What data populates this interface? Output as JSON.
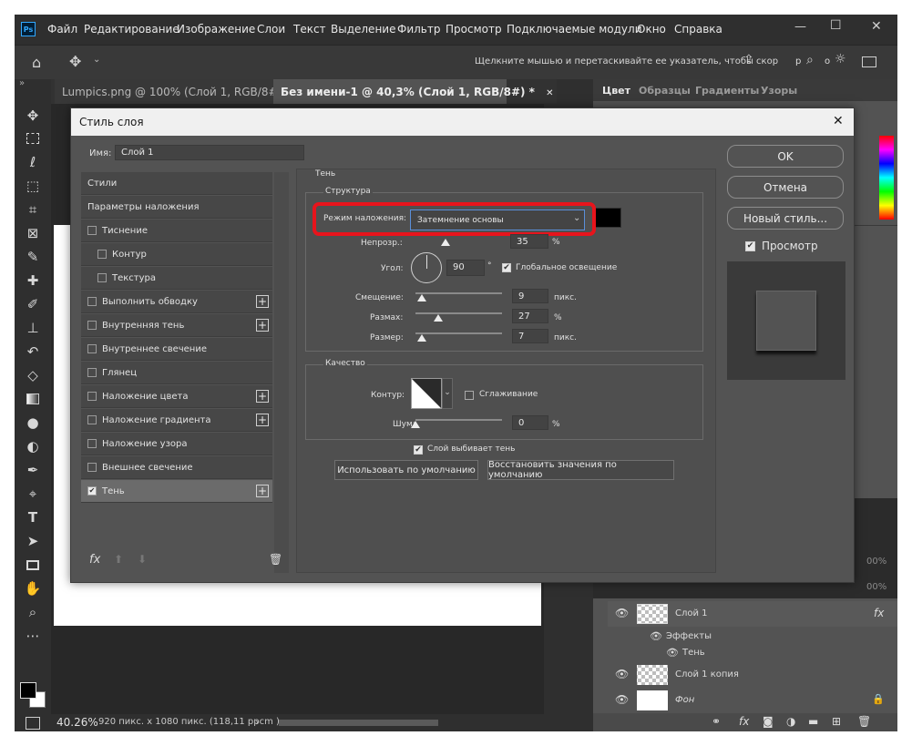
{
  "app": {
    "logo": "Ps",
    "menu": [
      "Файл",
      "Редактирование",
      "Изображение",
      "Слои",
      "Текст",
      "Выделение",
      "Фильтр",
      "Просмотр",
      "Подключаемые модули",
      "Окно",
      "Справка"
    ],
    "window_controls": {
      "minimize": "—",
      "maximize": "☐",
      "close": "✕"
    },
    "options_hint": "Щелкните мышью и перетаскивайте ее указатель, чтобы скор",
    "options_suffix_1": "р",
    "options_suffix_2": "о"
  },
  "tabs": [
    {
      "label": "Lumpics.png @ 100% (Слой 1, RGB/8#)",
      "close": "✕",
      "active": false
    },
    {
      "label": "Без имени-1 @ 40,3% (Слой 1, RGB/8#) *",
      "close": "✕",
      "active": true
    }
  ],
  "statusbar": {
    "zoom": "40.26%",
    "info": "920 пикс. x 1080 пикс. (118,11 ppcm )",
    "arrow": "›"
  },
  "panels": {
    "tabs": [
      "Цвет",
      "Образцы",
      "Градиенты",
      "Узоры"
    ],
    "zoom_values": [
      "00%",
      "00%"
    ],
    "layers": [
      {
        "name": "Слой 1",
        "fx": "fx"
      },
      {
        "name": "Эффекты"
      },
      {
        "name": "Тень"
      },
      {
        "name": "Слой 1 копия"
      },
      {
        "name": "Фон"
      }
    ],
    "footer_icons": [
      "link-icon",
      "fx-icon",
      "mask-icon",
      "adjustment-icon",
      "folder-icon",
      "new-layer-icon",
      "trash-icon"
    ]
  },
  "dialog": {
    "title": "Стиль слоя",
    "close": "✕",
    "name_label": "Имя:",
    "name_value": "Слой 1",
    "styles": [
      {
        "label": "Стили",
        "checkbox": false,
        "plus": false,
        "indent": false,
        "selected": false
      },
      {
        "label": "Параметры наложения",
        "checkbox": false,
        "plus": false,
        "indent": false,
        "selected": false
      },
      {
        "label": "Тиснение",
        "checkbox": true,
        "checked": false,
        "plus": false,
        "indent": false,
        "selected": false
      },
      {
        "label": "Контур",
        "checkbox": true,
        "checked": false,
        "plus": false,
        "indent": true,
        "selected": false
      },
      {
        "label": "Текстура",
        "checkbox": true,
        "checked": false,
        "plus": false,
        "indent": true,
        "selected": false
      },
      {
        "label": "Выполнить обводку",
        "checkbox": true,
        "checked": false,
        "plus": true,
        "indent": false,
        "selected": false
      },
      {
        "label": "Внутренняя тень",
        "checkbox": true,
        "checked": false,
        "plus": true,
        "indent": false,
        "selected": false
      },
      {
        "label": "Внутреннее свечение",
        "checkbox": true,
        "checked": false,
        "plus": false,
        "indent": false,
        "selected": false
      },
      {
        "label": "Глянец",
        "checkbox": true,
        "checked": false,
        "plus": false,
        "indent": false,
        "selected": false
      },
      {
        "label": "Наложение цвета",
        "checkbox": true,
        "checked": false,
        "plus": true,
        "indent": false,
        "selected": false
      },
      {
        "label": "Наложение градиента",
        "checkbox": true,
        "checked": false,
        "plus": true,
        "indent": false,
        "selected": false
      },
      {
        "label": "Наложение узора",
        "checkbox": true,
        "checked": false,
        "plus": false,
        "indent": false,
        "selected": false
      },
      {
        "label": "Внешнее свечение",
        "checkbox": true,
        "checked": false,
        "plus": false,
        "indent": false,
        "selected": false
      },
      {
        "label": "Тень",
        "checkbox": true,
        "checked": true,
        "plus": true,
        "indent": false,
        "selected": true
      }
    ],
    "footer": {
      "fx": "fx"
    },
    "section_title": "Тень",
    "structure": {
      "title": "Структура",
      "blend_label": "Режим наложения:",
      "blend_value": "Затемнение основы",
      "opacity_label": "Непрозр.:",
      "opacity_value": "35",
      "opacity_unit": "%",
      "angle_label": "Угол:",
      "angle_value": "90",
      "angle_unit": "°",
      "global_light_label": "Глобальное освещение",
      "distance_label": "Смещение:",
      "distance_value": "9",
      "distance_unit": "пикс.",
      "spread_label": "Размах:",
      "spread_value": "27",
      "spread_unit": "%",
      "size_label": "Размер:",
      "size_value": "7",
      "size_unit": "пикс."
    },
    "quality": {
      "title": "Качество",
      "contour_label": "Контур:",
      "antialias_label": "Сглаживание",
      "noise_label": "Шум:",
      "noise_value": "0",
      "noise_unit": "%"
    },
    "knockout_label": "Слой выбивает тень",
    "make_default": "Использовать по умолчанию",
    "reset_default": "Восстановить значения по умолчанию",
    "ok": "OK",
    "cancel": "Отмена",
    "new_style": "Новый стиль...",
    "preview_label": "Просмотр"
  },
  "colors": {
    "highlight": "#e8141c",
    "app_bg": "#535353",
    "menubar": "#2f2f2f"
  }
}
